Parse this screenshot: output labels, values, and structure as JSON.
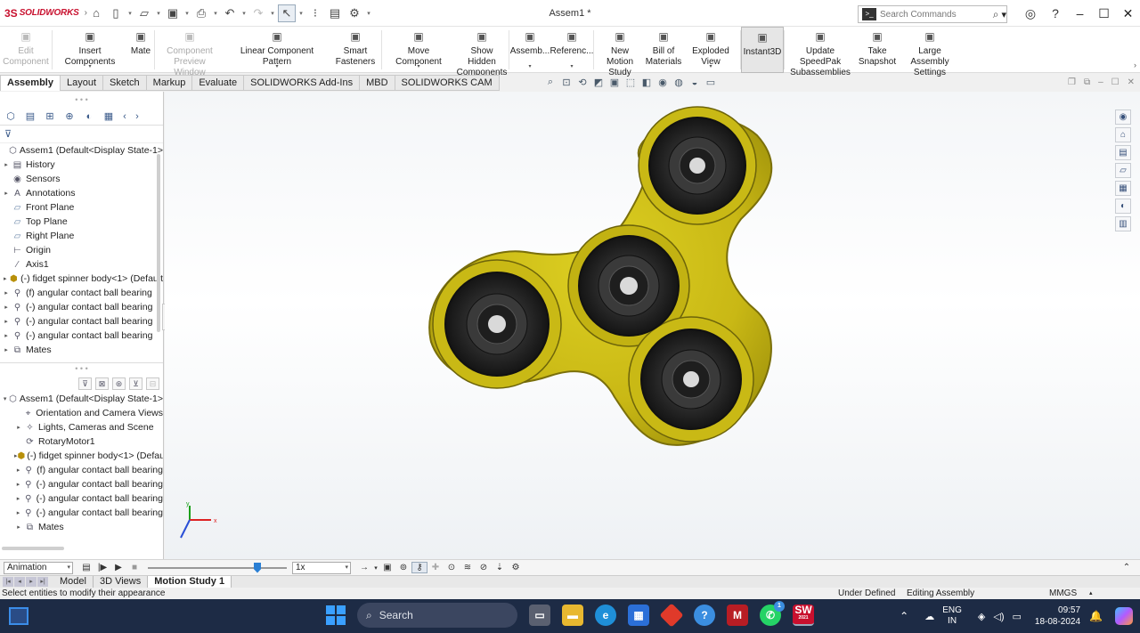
{
  "app": {
    "brand": "SOLIDWORKS",
    "doc_title": "Assem1 *",
    "search_placeholder": "Search Commands"
  },
  "ribbon": [
    {
      "label": "Edit\nComponent",
      "icon": "edit-component-icon",
      "disabled": true
    },
    {
      "label": "Insert Components",
      "icon": "insert-components-icon"
    },
    {
      "label": "Mate",
      "icon": "mate-icon"
    },
    {
      "label": "Component\nPreview Window",
      "icon": "preview-window-icon",
      "disabled": true
    },
    {
      "label": "Linear Component Pattern",
      "icon": "linear-pattern-icon"
    },
    {
      "label": "Smart\nFasteners",
      "icon": "smart-fasteners-icon"
    },
    {
      "label": "Move Component",
      "icon": "move-component-icon"
    },
    {
      "label": "Show Hidden\nComponents",
      "icon": "show-hidden-icon"
    },
    {
      "label": "Assemb...",
      "icon": "assembly-features-icon"
    },
    {
      "label": "Referenc...",
      "icon": "reference-geometry-icon"
    },
    {
      "label": "New Motion\nStudy",
      "icon": "motion-study-icon"
    },
    {
      "label": "Bill of\nMaterials",
      "icon": "bom-icon"
    },
    {
      "label": "Exploded View",
      "icon": "exploded-view-icon"
    },
    {
      "label": "Instant3D",
      "icon": "instant3d-icon",
      "active": true
    },
    {
      "label": "Update SpeedPak\nSubassemblies",
      "icon": "speedpak-icon"
    },
    {
      "label": "Take\nSnapshot",
      "icon": "snapshot-icon"
    },
    {
      "label": "Large Assembly\nSettings",
      "icon": "large-assembly-icon"
    }
  ],
  "command_tabs": [
    "Assembly",
    "Layout",
    "Sketch",
    "Markup",
    "Evaluate",
    "SOLIDWORKS Add-Ins",
    "MBD",
    "SOLIDWORKS CAM"
  ],
  "feature_tree": [
    {
      "label": "Assem1  (Default<Display State-1>",
      "icon": "assembly-icon",
      "exp": ""
    },
    {
      "label": "History",
      "icon": "history-icon",
      "exp": "▸"
    },
    {
      "label": "Sensors",
      "icon": "sensors-icon",
      "exp": ""
    },
    {
      "label": "Annotations",
      "icon": "annotations-icon",
      "exp": "▸"
    },
    {
      "label": "Front Plane",
      "icon": "plane-icon",
      "exp": ""
    },
    {
      "label": "Top Plane",
      "icon": "plane-icon",
      "exp": ""
    },
    {
      "label": "Right Plane",
      "icon": "plane-icon",
      "exp": ""
    },
    {
      "label": "Origin",
      "icon": "origin-icon",
      "exp": ""
    },
    {
      "label": "Axis1",
      "icon": "axis-icon",
      "exp": ""
    },
    {
      "label": "(-) fidget spinner body<1> (Default",
      "icon": "part-icon",
      "exp": "▸"
    },
    {
      "label": "(f) angular contact ball bearing",
      "icon": "bearing-icon",
      "exp": "▸"
    },
    {
      "label": "(-) angular contact ball bearing",
      "icon": "bearing-icon",
      "exp": "▸"
    },
    {
      "label": "(-) angular contact ball bearing",
      "icon": "bearing-icon",
      "exp": "▸"
    },
    {
      "label": "(-) angular contact ball bearing",
      "icon": "bearing-icon",
      "exp": "▸"
    },
    {
      "label": "Mates",
      "icon": "mates-icon",
      "exp": "▸"
    }
  ],
  "motion_tree": [
    {
      "label": "Assem1  (Default<Display State-1>",
      "icon": "assembly-icon",
      "exp": "▾"
    },
    {
      "label": "Orientation and Camera Views",
      "icon": "camera-icon",
      "exp": ""
    },
    {
      "label": "Lights, Cameras and Scene",
      "icon": "lights-icon",
      "exp": "▸"
    },
    {
      "label": "RotaryMotor1",
      "icon": "motor-icon",
      "exp": ""
    },
    {
      "label": "(-) fidget spinner body<1> (Default",
      "icon": "part-icon",
      "exp": "▸"
    },
    {
      "label": "(f) angular contact ball bearing",
      "icon": "bearing-icon",
      "exp": "▸"
    },
    {
      "label": "(-) angular contact ball bearing",
      "icon": "bearing-icon",
      "exp": "▸"
    },
    {
      "label": "(-) angular contact ball bearing",
      "icon": "bearing-icon",
      "exp": "▸"
    },
    {
      "label": "(-) angular contact ball bearing",
      "icon": "bearing-icon",
      "exp": "▸"
    },
    {
      "label": "Mates",
      "icon": "mates-icon",
      "exp": "▸"
    }
  ],
  "timeline": {
    "study_type": "Animation",
    "playback_speed": "1x",
    "slider_value": 0.78
  },
  "bottom_tabs": [
    "Model",
    "3D Views",
    "Motion Study 1"
  ],
  "status": {
    "hint": "Select entities to modify their appearance",
    "definition": "Under Defined",
    "mode": "Editing Assembly",
    "units": "MMGS"
  },
  "triad": {
    "x": "x",
    "y": "y"
  },
  "taskbar": {
    "search": "Search",
    "lang_line1": "ENG",
    "lang_line2": "IN",
    "time": "09:57",
    "date": "18-08-2024",
    "whatsapp_badge": "1",
    "solidworks_badge": "2021"
  },
  "colors": {
    "spinner_body": "#d4c418",
    "bearing": "#2b2b2b",
    "brand": "#c8102e",
    "taskbar": "#1d2b45"
  }
}
